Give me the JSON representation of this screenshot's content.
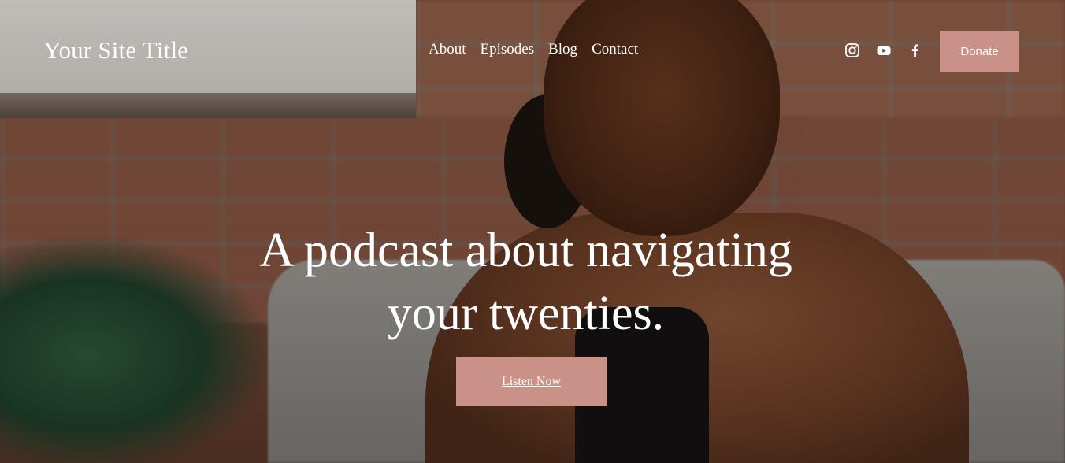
{
  "header": {
    "site_title": "Your Site Title",
    "nav": [
      {
        "label": "About"
      },
      {
        "label": "Episodes"
      },
      {
        "label": "Blog"
      },
      {
        "label": "Contact"
      }
    ],
    "social": [
      {
        "icon": "instagram-icon"
      },
      {
        "icon": "youtube-icon"
      },
      {
        "icon": "facebook-icon"
      }
    ],
    "donate_label": "Donate"
  },
  "hero": {
    "headline_line1": "A podcast about navigating",
    "headline_line2": "your twenties.",
    "cta_label": "Listen Now"
  },
  "colors": {
    "accent": "#c99188",
    "text": "#ffffff"
  }
}
